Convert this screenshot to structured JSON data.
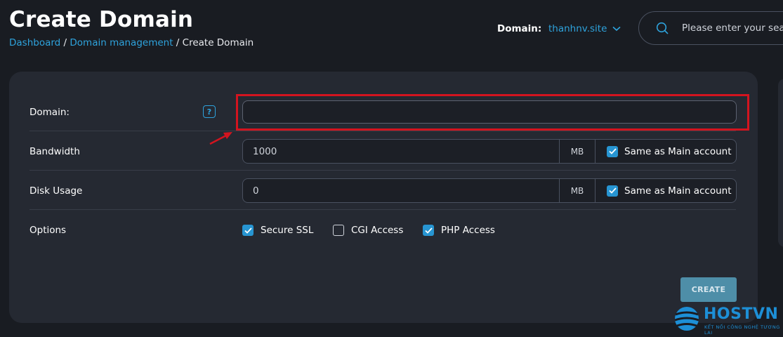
{
  "header": {
    "title": "Create Domain",
    "breadcrumb": [
      "Dashboard",
      "Domain management",
      "Create Domain"
    ],
    "breadcrumb_sep": " / ",
    "domain_label": "Domain:",
    "domain_value": "thanhnv.site",
    "search_placeholder": "Please enter your search"
  },
  "form": {
    "domain": {
      "label": "Domain:",
      "help": "?",
      "value": ""
    },
    "bandwidth": {
      "label": "Bandwidth",
      "value": "1000",
      "unit": "MB",
      "same_label": "Same as Main account",
      "same_checked": true
    },
    "disk": {
      "label": "Disk Usage",
      "value": "0",
      "unit": "MB",
      "same_label": "Same as Main account",
      "same_checked": true
    },
    "options": {
      "label": "Options",
      "items": [
        {
          "label": "Secure SSL",
          "checked": true
        },
        {
          "label": "CGI Access",
          "checked": false
        },
        {
          "label": "PHP Access",
          "checked": true
        }
      ]
    },
    "create_label": "CREATE"
  },
  "logo": {
    "name": "HOSTVN",
    "tagline": "KẾT NỐI CÔNG NGHỆ TƯƠNG LAI"
  },
  "colors": {
    "accent": "#2ea3dd",
    "highlight": "#d3141f",
    "panel": "#252932",
    "background": "#191c22"
  }
}
